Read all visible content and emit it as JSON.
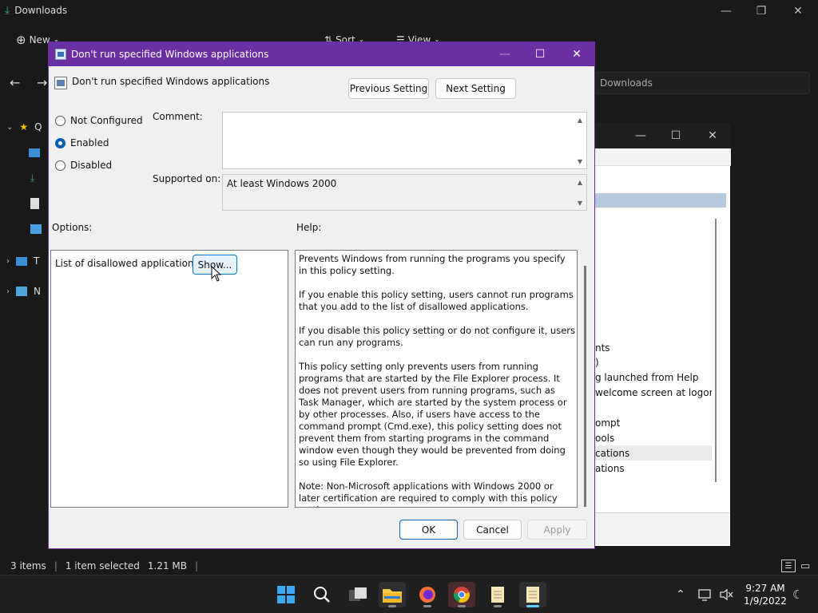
{
  "explorer": {
    "title": "Downloads",
    "toolbar": {
      "new_label": "New",
      "sort_label": "Sort",
      "view_label": "View",
      "more_label": "…"
    },
    "address": "Downloads",
    "sidebar_partial": [
      "Q",
      "",
      "",
      "",
      "",
      "T",
      "N"
    ],
    "status": {
      "items": "3 items",
      "selected": "1 item selected",
      "size": "1.21 MB"
    }
  },
  "midwin_list": [
    "nts",
    ")",
    "g launched from Help",
    "welcome screen at logon",
    "",
    "ompt",
    "ools",
    "cations",
    "ations"
  ],
  "dialog": {
    "title": "Don't run specified Windows applications",
    "header_text": "Don't run specified Windows applications",
    "prev_label": "Previous Setting",
    "next_label": "Next Setting",
    "radios": [
      {
        "label": "Not Configured",
        "checked": false
      },
      {
        "label": "Enabled",
        "checked": true
      },
      {
        "label": "Disabled",
        "checked": false
      }
    ],
    "comment_label": "Comment:",
    "supported_label": "Supported on:",
    "supported_value": "At least Windows 2000",
    "options_label": "Options:",
    "help_label": "Help:",
    "option_item": "List of disallowed applications",
    "show_label": "Show...",
    "help_paragraphs": [
      "Prevents Windows from running the programs you specify in this policy setting.",
      "If you enable this policy setting, users cannot run programs that you add to the list of disallowed applications.",
      "If you disable this policy setting or do not configure it, users can run any programs.",
      "This policy setting only prevents users from running programs that are started by the File Explorer process. It does not prevent users from running programs, such as Task Manager, which are started by the system process or by other processes.  Also, if users have access to the command prompt (Cmd.exe), this policy setting does not prevent them from starting programs in the command window even though they would be prevented from doing so using File Explorer.",
      "Note: Non-Microsoft applications with Windows 2000 or later certification are required to comply with this policy setting.\nNote: To create a list of allowed applications, click Show.  In the"
    ],
    "ok_label": "OK",
    "cancel_label": "Cancel",
    "apply_label": "Apply"
  },
  "taskbar": {
    "time": "9:27 AM",
    "date": "1/9/2022"
  },
  "colors": {
    "titlebar": "#6b2fa3",
    "accent": "#005fb8"
  }
}
